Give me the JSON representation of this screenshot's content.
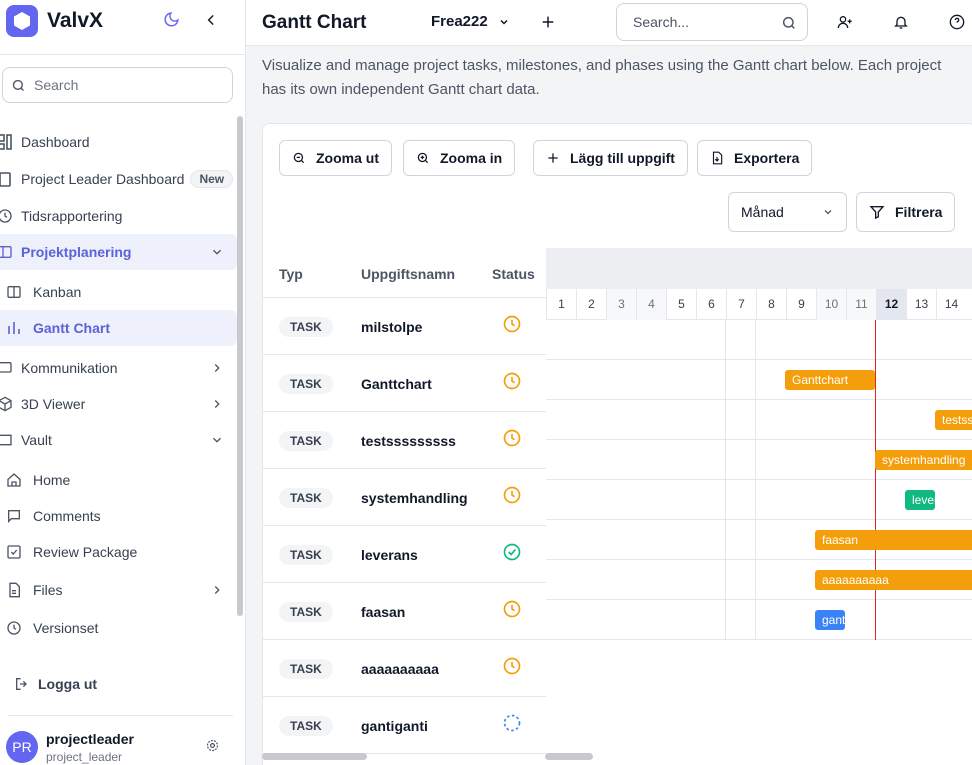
{
  "app": {
    "name": "ValvX"
  },
  "sidebar": {
    "search_placeholder": "Search",
    "items": [
      {
        "label": "Dashboard"
      },
      {
        "label": "Project Leader Dashboard",
        "badge": "New"
      },
      {
        "label": "Tidsrapportering"
      },
      {
        "label": "Projektplanering"
      },
      {
        "label": "Kanban"
      },
      {
        "label": "Gantt Chart"
      },
      {
        "label": "Kommunikation"
      },
      {
        "label": "3D Viewer"
      },
      {
        "label": "Vault"
      },
      {
        "label": "Home"
      },
      {
        "label": "Comments"
      },
      {
        "label": "Review Package"
      },
      {
        "label": "Files"
      },
      {
        "label": "Versionset"
      }
    ],
    "logout_label": "Logga ut",
    "user": {
      "initials": "PR",
      "name": "projectleader",
      "role": "project_leader"
    }
  },
  "header": {
    "title": "Gantt Chart",
    "project": "Frea222",
    "search_placeholder": "Search..."
  },
  "main": {
    "description": "Visualize and manage project tasks, milestones, and phases using the Gantt chart below. Each project has its own independent Gantt chart data.",
    "toolbar": {
      "zoom_out": "Zooma ut",
      "zoom_in": "Zooma in",
      "add_task": "Lägg till uppgift",
      "export": "Exportera",
      "view_select": "Månad",
      "filter": "Filtrera"
    },
    "columns": {
      "type": "Typ",
      "name": "Uppgiftsnamn",
      "status": "Status"
    },
    "tasks": [
      {
        "type": "TASK",
        "name": "milstolpe",
        "status": "pending"
      },
      {
        "type": "TASK",
        "name": "Ganttchart",
        "status": "pending"
      },
      {
        "type": "TASK",
        "name": "testsssssssss",
        "status": "pending"
      },
      {
        "type": "TASK",
        "name": "systemhandling",
        "status": "pending"
      },
      {
        "type": "TASK",
        "name": "leverans",
        "status": "completed"
      },
      {
        "type": "TASK",
        "name": "faasan",
        "status": "pending"
      },
      {
        "type": "TASK",
        "name": "aaaaaaaaaa",
        "status": "pending"
      },
      {
        "type": "TASK",
        "name": "gantiganti",
        "status": "not-started"
      }
    ],
    "days": [
      "1",
      "2",
      "3",
      "4",
      "5",
      "6",
      "7",
      "8",
      "9",
      "10",
      "11",
      "12",
      "13",
      "14"
    ],
    "today": "12",
    "bars": [
      {
        "label": "Ganttchart",
        "color": "#f59e0b"
      },
      {
        "label": "testsss",
        "color": "#f59e0b"
      },
      {
        "label": "systemhandling",
        "color": "#f59e0b"
      },
      {
        "label": "leverans",
        "color": "#10b981"
      },
      {
        "label": "faasan",
        "color": "#f59e0b"
      },
      {
        "label": "aaaaaaaaaa",
        "color": "#f59e0b"
      },
      {
        "label": "gantiganti",
        "color": "#3b82f6"
      }
    ],
    "colors": {
      "accent": "#6366f1",
      "pending": "#f59e0b",
      "done": "#10b981",
      "today_line": "#dc2626"
    }
  }
}
